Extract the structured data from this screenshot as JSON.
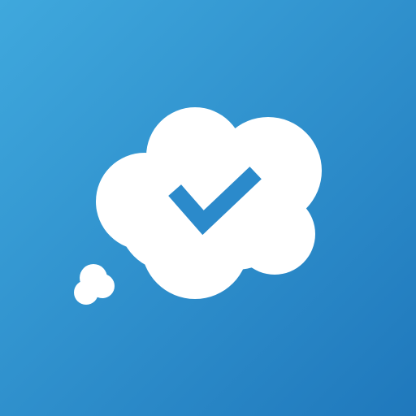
{
  "icon": {
    "name": "thought-bubble-check",
    "colors": {
      "gradient_start": "#3FA8DD",
      "gradient_end": "#1F78BC",
      "bubble": "#FFFFFF",
      "check": "#2B8ACB"
    }
  }
}
